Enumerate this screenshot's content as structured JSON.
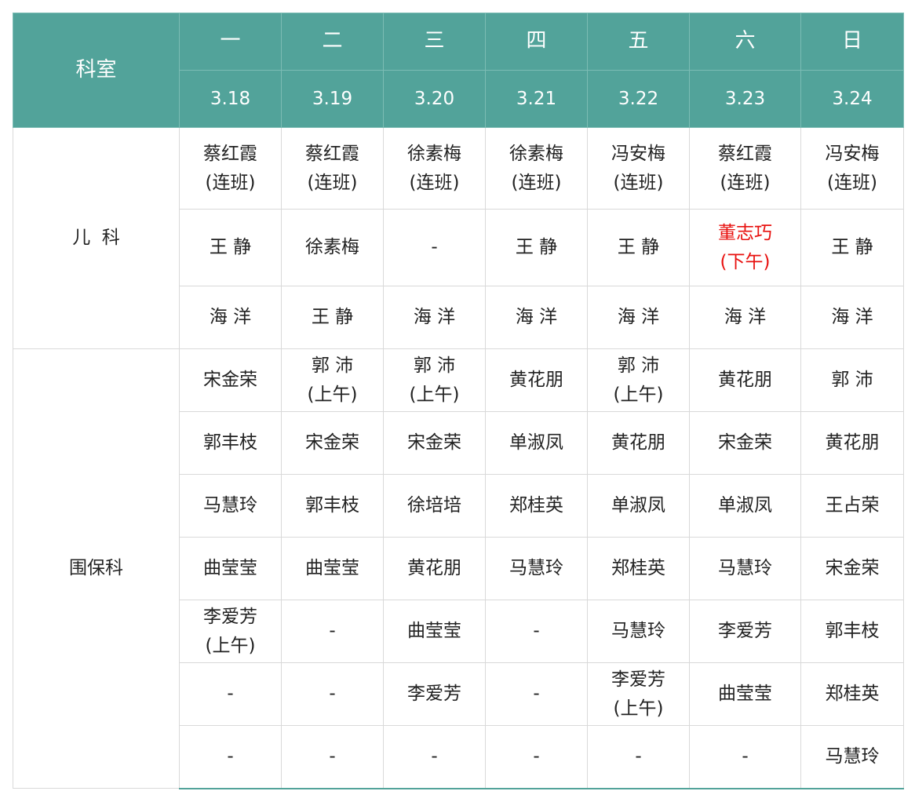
{
  "header": {
    "dept_label": "科室",
    "days": [
      "一",
      "二",
      "三",
      "四",
      "五",
      "六",
      "日"
    ],
    "dates": [
      "3.18",
      "3.19",
      "3.20",
      "3.21",
      "3.22",
      "3.23",
      "3.24"
    ]
  },
  "colors": {
    "header_bg": "#52a39a",
    "highlight": "#e8110f"
  },
  "departments": [
    {
      "name": "儿  科",
      "rows": [
        {
          "h": 104,
          "cells": [
            "蔡红霞\n(连班)",
            "蔡红霞\n(连班)",
            "徐素梅\n(连班)",
            "徐素梅\n(连班)",
            "冯安梅\n(连班)",
            "蔡红霞\n(连班)",
            "冯安梅\n(连班)"
          ]
        },
        {
          "h": 98,
          "cells": [
            "王   静",
            "徐素梅",
            "-",
            "王   静",
            "王   静",
            "董志巧\n(下午)",
            "王   静"
          ]
        },
        {
          "h": 80,
          "cells": [
            "海   洋",
            "王   静",
            "海   洋",
            "海   洋",
            "海   洋",
            "海   洋",
            "海   洋"
          ]
        }
      ]
    },
    {
      "name": "围保科",
      "rows": [
        {
          "h": 80,
          "cells": [
            "宋金荣",
            "郭   沛\n(上午)",
            "郭   沛\n(上午)",
            "黄花朋",
            "郭   沛\n(上午)",
            "黄花朋",
            "郭   沛"
          ]
        },
        {
          "h": 80,
          "cells": [
            "郭丰枝",
            "宋金荣",
            "宋金荣",
            "单淑凤",
            "黄花朋",
            "宋金荣",
            "黄花朋"
          ]
        },
        {
          "h": 80,
          "cells": [
            "马慧玲",
            "郭丰枝",
            "徐培培",
            "郑桂英",
            "单淑凤",
            "单淑凤",
            "王占荣"
          ]
        },
        {
          "h": 80,
          "cells": [
            "曲莹莹",
            "曲莹莹",
            "黄花朋",
            "马慧玲",
            "郑桂英",
            "马慧玲",
            "宋金荣"
          ]
        },
        {
          "h": 80,
          "cells": [
            "李爱芳\n(上午)",
            "-",
            "曲莹莹",
            "-",
            "马慧玲",
            "李爱芳",
            "郭丰枝"
          ]
        },
        {
          "h": 80,
          "cells": [
            "-",
            "-",
            "李爱芳",
            "-",
            "李爱芳\n(上午)",
            "曲莹莹",
            "郑桂英"
          ]
        },
        {
          "h": 80,
          "cells": [
            "-",
            "-",
            "-",
            "-",
            "-",
            "-",
            "马慧玲"
          ]
        }
      ]
    }
  ],
  "highlighted_cells": [
    {
      "dept": 0,
      "row": 1,
      "col": 5
    }
  ]
}
